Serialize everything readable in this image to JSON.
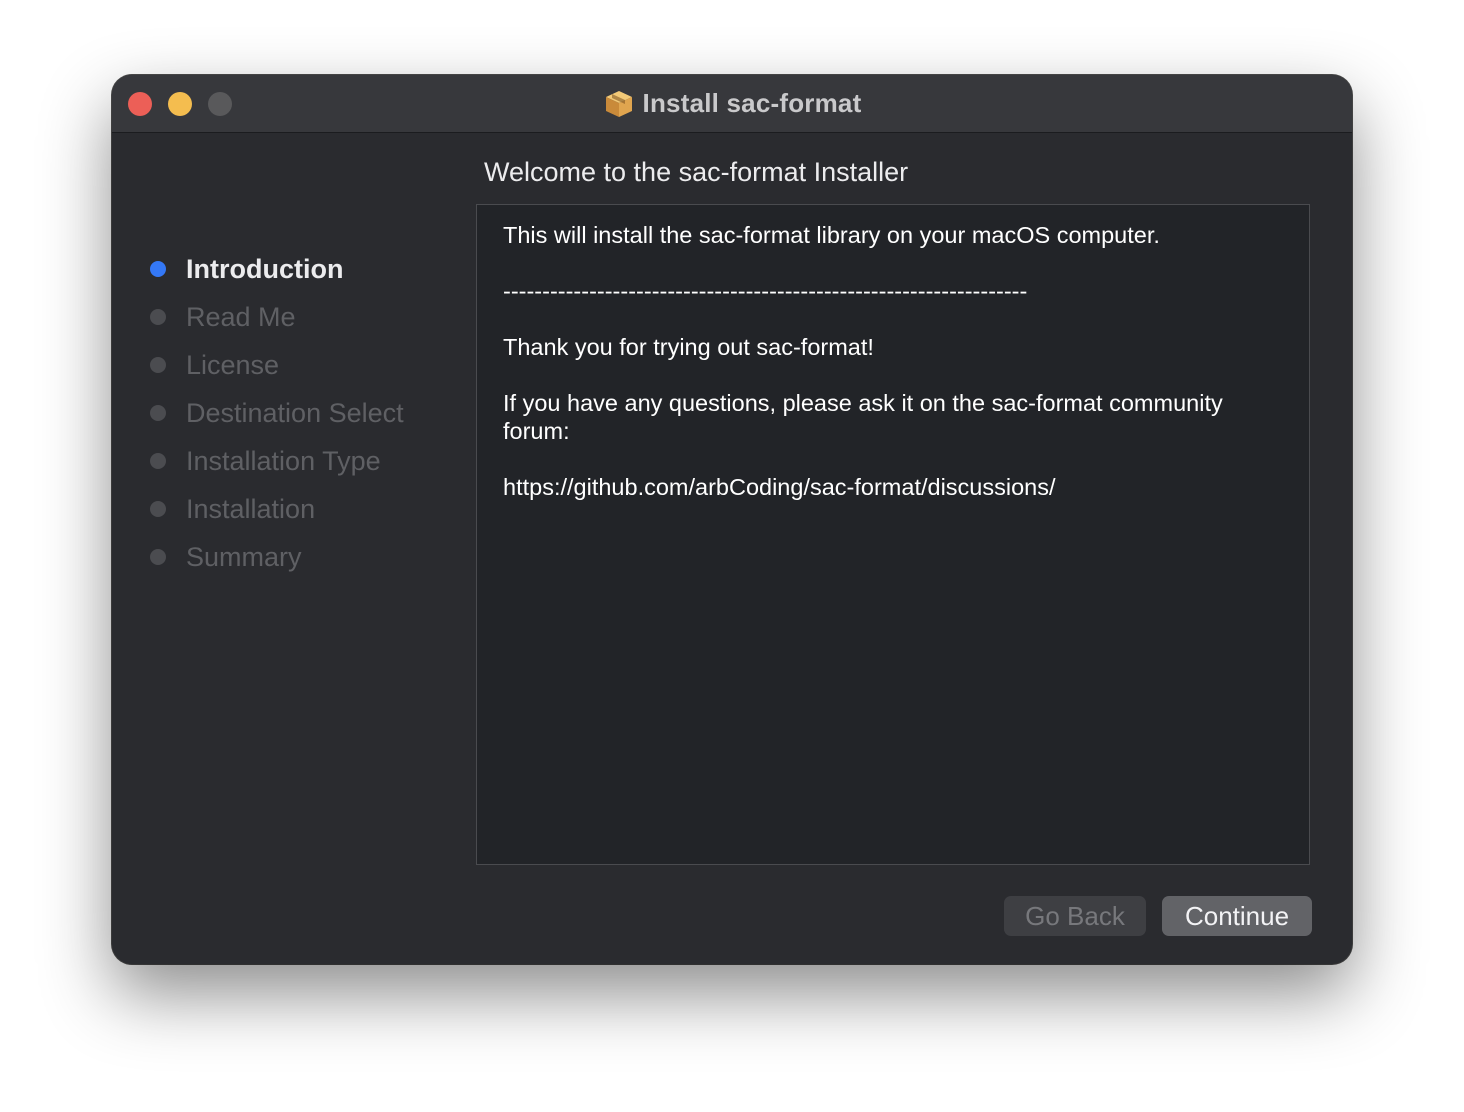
{
  "window": {
    "title": "Install sac-format",
    "icon": "package-icon"
  },
  "sidebar": {
    "steps": [
      {
        "label": "Introduction",
        "active": true
      },
      {
        "label": "Read Me",
        "active": false
      },
      {
        "label": "License",
        "active": false
      },
      {
        "label": "Destination Select",
        "active": false
      },
      {
        "label": "Installation Type",
        "active": false
      },
      {
        "label": "Installation",
        "active": false
      },
      {
        "label": "Summary",
        "active": false
      }
    ]
  },
  "main": {
    "heading": "Welcome to the sac-format Installer",
    "paragraphs": [
      "This will install the sac-format library on your macOS computer.",
      "-------------------------------------------------------------------",
      "Thank you for trying out sac-format!",
      "If you have any questions, please ask it on the sac-format community forum:",
      "https://github.com/arbCoding/sac-format/discussions/"
    ]
  },
  "buttons": {
    "back": "Go Back",
    "continue": "Continue"
  },
  "colors": {
    "accent": "#3478f6",
    "close": "#ec5f57",
    "minimize": "#f4bd4f",
    "zoom_disabled": "#59595b"
  }
}
